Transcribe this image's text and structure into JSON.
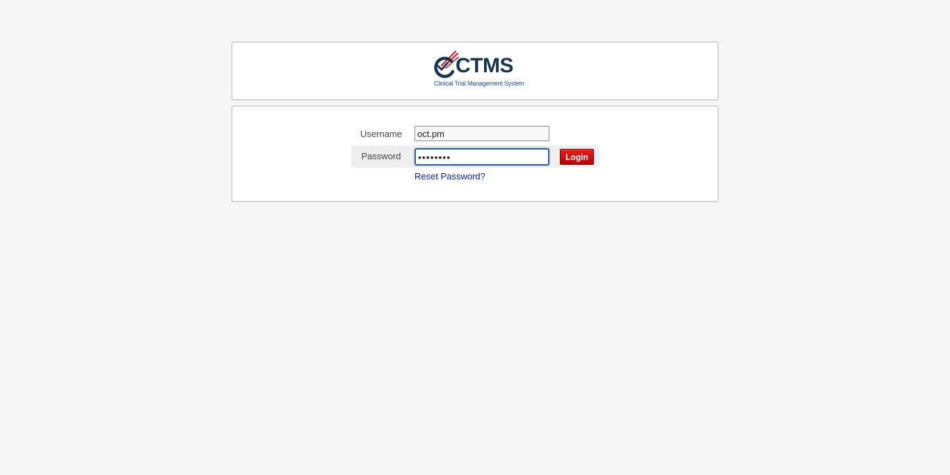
{
  "brand": {
    "logo_text": "CTMS",
    "logo_subtitle": "Clinical Trial Management System"
  },
  "login_form": {
    "username_label": "Username",
    "username_value": "oct.pm",
    "password_label": "Password",
    "password_value": "••••••••",
    "login_button_label": "Login",
    "reset_password_link": "Reset Password?"
  },
  "colors": {
    "page_background": "#f6f6f6",
    "logo_navy": "#17344f",
    "logo_red": "#d01a2a",
    "login_button_red": "#cc0000",
    "link_blue": "#0a1c9a",
    "focus_border": "#2f5fa8"
  }
}
